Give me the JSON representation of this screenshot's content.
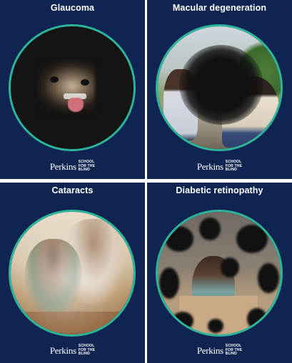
{
  "panels": [
    {
      "title": "Glaucoma",
      "logo_word": "Perkins",
      "logo_lines": [
        "SCHOOL",
        "FOR THE",
        "BLIND"
      ]
    },
    {
      "title": "Macular degeneration",
      "logo_word": "Perkins",
      "logo_lines": [
        "SCHOOL",
        "FOR THE",
        "BLIND"
      ]
    },
    {
      "title": "Cataracts",
      "logo_word": "Perkins",
      "logo_lines": [
        "SCHOOL",
        "FOR THE",
        "BLIND"
      ]
    },
    {
      "title": "Diabetic retinopathy",
      "logo_word": "Perkins",
      "logo_lines": [
        "SCHOOL",
        "FOR THE",
        "BLIND"
      ]
    }
  ],
  "colors": {
    "panel_bg": "#0f2450",
    "circle_border": "#2bb59a",
    "text": "#ffffff"
  }
}
